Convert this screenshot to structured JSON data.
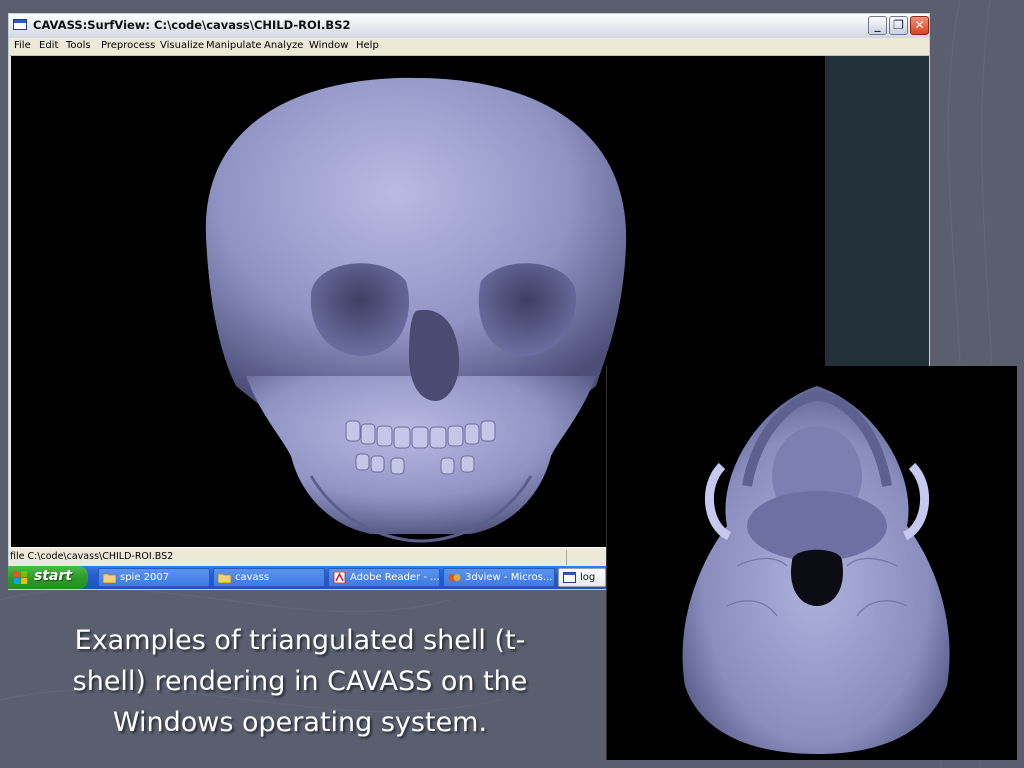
{
  "window": {
    "title": "CAVASS:SurfView: C:\\code\\cavass\\CHILD-ROI.BS2",
    "controls": [
      "minimize-icon",
      "maximize-icon",
      "close-icon"
    ]
  },
  "menu": {
    "items": [
      "File",
      "Edit",
      "Tools",
      "Preprocess",
      "Visualize",
      "Manipulate",
      "Analyze",
      "Window",
      "Help"
    ]
  },
  "status": {
    "text": "file C:\\code\\cavass\\CHILD-ROI.BS2"
  },
  "taskbar": {
    "start_label": "start",
    "tasks": [
      {
        "label": "spie 2007",
        "icon": "folder-icon"
      },
      {
        "label": "cavass",
        "icon": "folder-icon"
      },
      {
        "label": "Adobe Reader - ...",
        "icon": "adobe-reader-icon"
      },
      {
        "label": "3dview - Micros...",
        "icon": "application-icon"
      },
      {
        "label": "log",
        "icon": "window-icon"
      }
    ]
  },
  "caption": {
    "line1": "Examples of triangulated shell (t-",
    "line2": "shell) rendering in CAVASS on the",
    "line3": "Windows operating system."
  },
  "colors": {
    "slide_background": "#5a5e6e",
    "skull_surface": "#9799c8",
    "viewport_background": "#000000",
    "side_panel": "#223038"
  }
}
